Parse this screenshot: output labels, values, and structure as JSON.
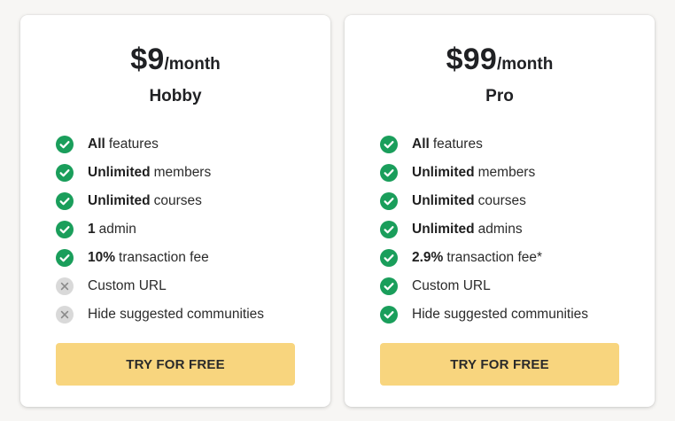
{
  "colors": {
    "check": "#1a9e5b",
    "cross_bg": "#d9d9d9",
    "cross_fg": "#8a8a8a",
    "button": "#f8d57e"
  },
  "plans": [
    {
      "price": "$9",
      "period": "/month",
      "name": "Hobby",
      "button_label": "TRY FOR FREE",
      "features": [
        {
          "bold": "All",
          "text": "features",
          "included": true,
          "icon": "check-circle-icon"
        },
        {
          "bold": "Unlimited",
          "text": "members",
          "included": true,
          "icon": "check-circle-icon"
        },
        {
          "bold": "Unlimited",
          "text": "courses",
          "included": true,
          "icon": "check-circle-icon"
        },
        {
          "bold": "1",
          "text": "admin",
          "included": true,
          "icon": "check-circle-icon"
        },
        {
          "bold": "10%",
          "text": "transaction fee",
          "included": true,
          "icon": "check-circle-icon"
        },
        {
          "bold": "",
          "text": "Custom URL",
          "included": false,
          "icon": "x-circle-icon"
        },
        {
          "bold": "",
          "text": "Hide suggested communities",
          "included": false,
          "icon": "x-circle-icon"
        }
      ]
    },
    {
      "price": "$99",
      "period": "/month",
      "name": "Pro",
      "button_label": "TRY FOR FREE",
      "features": [
        {
          "bold": "All",
          "text": "features",
          "included": true,
          "icon": "check-circle-icon"
        },
        {
          "bold": "Unlimited",
          "text": "members",
          "included": true,
          "icon": "check-circle-icon"
        },
        {
          "bold": "Unlimited",
          "text": "courses",
          "included": true,
          "icon": "check-circle-icon"
        },
        {
          "bold": "Unlimited",
          "text": "admins",
          "included": true,
          "icon": "check-circle-icon"
        },
        {
          "bold": "2.9%",
          "text": "transaction fee*",
          "included": true,
          "icon": "check-circle-icon"
        },
        {
          "bold": "",
          "text": "Custom URL",
          "included": true,
          "icon": "check-circle-icon"
        },
        {
          "bold": "",
          "text": "Hide suggested communities",
          "included": true,
          "icon": "check-circle-icon"
        }
      ]
    }
  ]
}
